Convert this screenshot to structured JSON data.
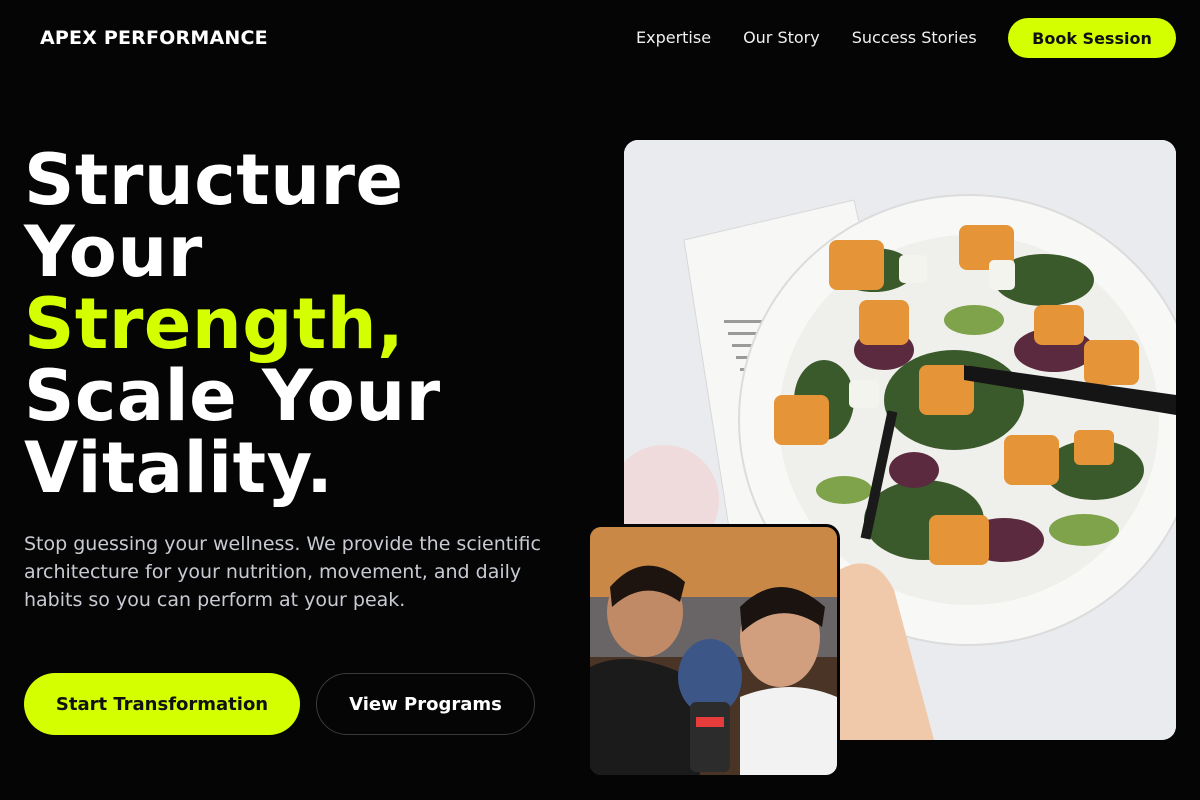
{
  "nav": {
    "logo": "APEX PERFORMANCE",
    "links": [
      "Expertise",
      "Our Story",
      "Success Stories"
    ],
    "cta": "Book Session"
  },
  "hero": {
    "title_line1": "Structure",
    "title_line2": "Your",
    "title_accent": "Strength,",
    "title_line4": "Scale Your",
    "title_line5": "Vitality.",
    "subtitle": "Stop guessing your wellness. We provide the scientific architecture for your nutrition, movement, and daily habits so you can perform at your peak.",
    "primary_button": "Start Transformation",
    "secondary_button": "View Programs"
  },
  "images": {
    "main": "salad-bowl-photo",
    "secondary": "boxing-partners-photo"
  },
  "colors": {
    "accent": "#d4ff00",
    "background": "#050505"
  }
}
